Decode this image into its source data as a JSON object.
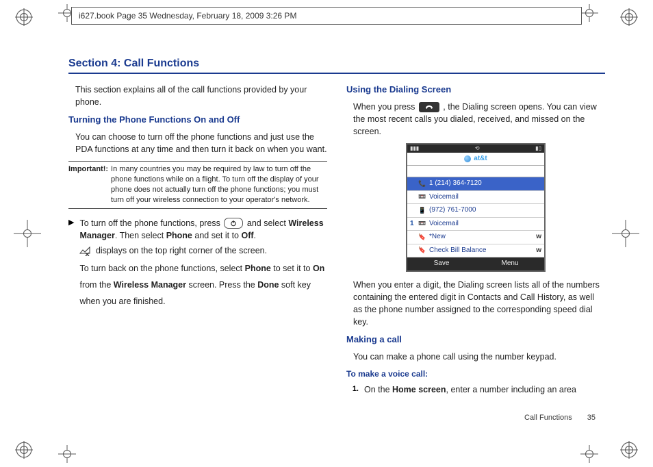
{
  "running_header": "i627.book  Page 35  Wednesday, February 18, 2009  3:26 PM",
  "section_title": "Section 4: Call Functions",
  "intro": "This section explains all of the call functions provided by your phone.",
  "left": {
    "h1": "Turning the Phone Functions On and Off",
    "p1": "You can choose to turn off the phone functions and just use the PDA functions at any time and then turn it back on when you want.",
    "important_label": "Important!:",
    "important_text": "In many countries you may be required by law to turn off the phone functions while on a flight. To turn off the display of your phone does not actually turn off the phone functions; you must turn off your wireless connection to your operator's network.",
    "step_a_1": "To turn off the phone functions, press ",
    "step_a_2": " and select ",
    "step_a_wm": "Wireless Manager",
    "step_a_3": ". Then select ",
    "step_a_phone": "Phone",
    "step_a_4": " and set it to ",
    "step_a_off": "Off",
    "step_a_5": ".",
    "step_b": " displays on the top right corner of the screen.",
    "step_c_1": "To turn back on the phone functions, select ",
    "step_c_phone": "Phone",
    "step_c_2": " to set it to ",
    "step_c_on": "On",
    "step_c_3": " from the ",
    "step_c_wm": "Wireless Manager",
    "step_c_4": " screen. Press the ",
    "step_c_done": "Done",
    "step_c_5": " soft key when you are finished."
  },
  "right": {
    "h1": "Using the Dialing Screen",
    "p1_a": "When you press ",
    "p1_b": ", the Dialing screen opens. You can view the most recent calls you dialed, received, and missed on the screen.",
    "shot": {
      "brand": "at&t",
      "rows": [
        {
          "n": "",
          "label": "1 (214) 364-7120",
          "trail": "",
          "sel": true
        },
        {
          "n": "",
          "label": "Voicemail",
          "trail": ""
        },
        {
          "n": "",
          "label": "(972) 761-7000",
          "trail": ""
        },
        {
          "n": "1",
          "label": "Voicemail",
          "trail": ""
        },
        {
          "n": "",
          "label": "*New",
          "trail": "w"
        },
        {
          "n": "",
          "label": "Check Bill Balance",
          "trail": "w"
        }
      ],
      "soft_left": "Save",
      "soft_right": "Menu"
    },
    "p2": "When you enter a digit, the Dialing screen lists all of the numbers containing the entered digit in Contacts and Call History, as well as the phone number assigned to the corresponding speed dial key.",
    "h2": "Making a call",
    "p3": "You can make a phone call using the number keypad.",
    "h3": "To make a voice call:",
    "step1_n": "1.",
    "step1_a": "On the ",
    "step1_home": "Home screen",
    "step1_b": ", enter a number including an area"
  },
  "footer_label": "Call Functions",
  "footer_page": "35"
}
